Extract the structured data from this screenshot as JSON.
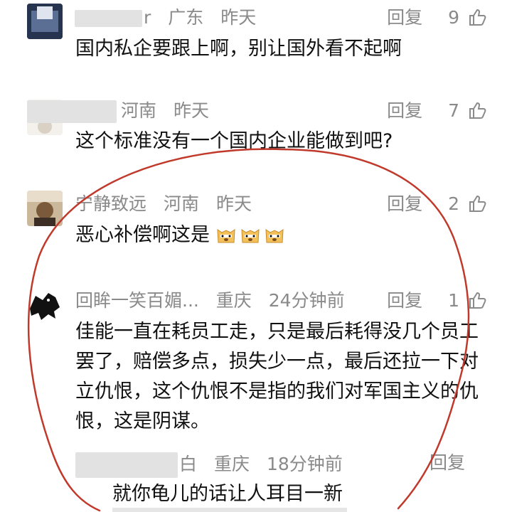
{
  "comments": [
    {
      "user_visible": "r",
      "location": "广东",
      "time": "昨天",
      "reply_label": "回复",
      "likes": "9",
      "text": "国内私企要跟上啊，别让国外看不起啊"
    },
    {
      "user_visible": "",
      "location": "河南",
      "time": "昨天",
      "reply_label": "回复",
      "likes": "7",
      "text": "这个标准没有一个国内企业能做到吧?"
    },
    {
      "user_visible": "宁静致远",
      "location": "河南",
      "time": "昨天",
      "reply_label": "回复",
      "likes": "2",
      "text": "恶心补偿啊这是",
      "emoji": "doge-emoji"
    },
    {
      "user_visible": "回眸一笑百媚...",
      "location": "重庆",
      "time": "24分钟前",
      "reply_label": "回复",
      "likes": "1",
      "text": "佳能一直在耗员工走，只是最后耗得没几个员工罢了，赔偿多点，损失少一点，最后还拉一下对立仇恨，这个仇恨不是指的我们对军国主义的仇恨，这是阴谋。"
    }
  ],
  "reply": {
    "user_visible": "白",
    "location": "重庆",
    "time": "18分钟前",
    "reply_label": "回复",
    "text": "就你龟儿的话让人耳目一新"
  },
  "annotation_color": "#c0392b",
  "like_icon": "thumbs-up-icon"
}
